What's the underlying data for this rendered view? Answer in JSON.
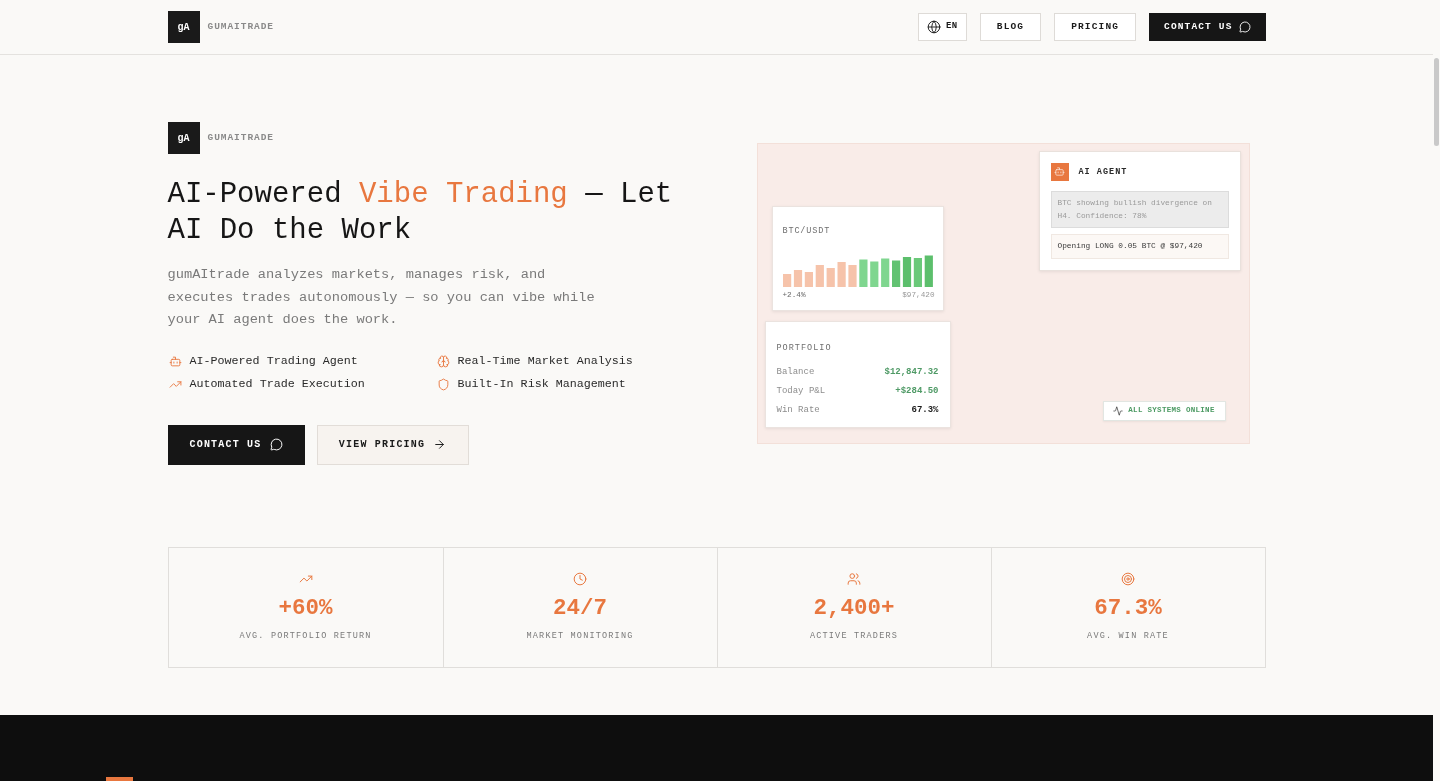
{
  "header": {
    "logo_mark": "gA",
    "brand": "GUMAITRADE",
    "actions": [
      {
        "kind": "language",
        "label": "EN"
      },
      {
        "kind": "link",
        "label": "BLOG"
      },
      {
        "kind": "link",
        "label": "PRICING"
      },
      {
        "kind": "cta",
        "label": "CONTACT US"
      }
    ]
  },
  "hero": {
    "logo_mark": "gA",
    "brand": "GUMAITRADE",
    "title_parts": [
      {
        "text": "AI-Powered ",
        "highlight": false
      },
      {
        "text": "Vibe Trading",
        "highlight": true
      },
      {
        "text": " — Let AI Do the Work",
        "highlight": false
      }
    ],
    "description": "gumAItrade analyzes markets, manages risk, and executes trades autonomously — so you can vibe while your AI agent does the work.",
    "features": [
      "AI-Powered Trading Agent",
      "Real-Time Market Analysis",
      "Automated Trade Execution",
      "Built-In Risk Management"
    ],
    "buttons": [
      {
        "kind": "primary",
        "label": "CONTACT US"
      },
      {
        "kind": "secondary",
        "label": "VIEW PRICING"
      }
    ]
  },
  "visual": {
    "agent": {
      "title": "AI AGENT",
      "messages": [
        {
          "kind": "analysis",
          "text": "BTC showing bullish divergence on H4. Confidence: 78%"
        },
        {
          "kind": "action",
          "text": "Opening LONG 0.05 BTC @ $97,420"
        }
      ]
    },
    "price_card": {
      "pair": "BTC/USDT",
      "change": "+2.4%",
      "price": "$97,420"
    },
    "portfolio": {
      "title": "PORTFOLIO",
      "rows": [
        {
          "label": "Balance",
          "value": "$12,847.32",
          "color": "#4f9a66"
        },
        {
          "label": "Today P&L",
          "value": "+$284.50",
          "color": "#4f9a66"
        },
        {
          "label": "Win Rate",
          "value": "67.3%",
          "color": "#1a1a1a"
        }
      ]
    },
    "status": "ALL SYSTEMS ONLINE"
  },
  "stats": [
    {
      "value": "+60%",
      "label": "AVG. PORTFOLIO RETURN"
    },
    {
      "value": "24/7",
      "label": "MARKET MONITORING"
    },
    {
      "value": "2,400+",
      "label": "ACTIVE TRADERS"
    },
    {
      "value": "67.3%",
      "label": "AVG. WIN RATE"
    }
  ]
}
